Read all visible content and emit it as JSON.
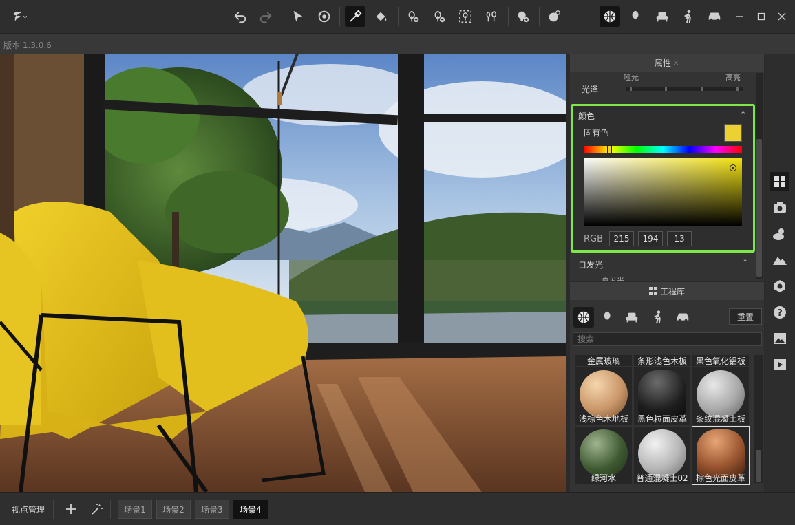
{
  "version": "版本 1.3.0.6",
  "toolbar": {
    "buttons": [
      "logo-menu",
      "undo",
      "redo",
      "select",
      "orbit",
      "eyedropper",
      "paint-bucket",
      "add-plant",
      "remove-plant",
      "plant-settings",
      "forest",
      "add-light",
      "weather"
    ],
    "categories": [
      "material",
      "plants",
      "furniture",
      "people",
      "vehicles"
    ]
  },
  "properties": {
    "title": "属性",
    "gloss_label": "光泽",
    "gloss_low": "哑光",
    "gloss_high": "高亮",
    "color_section": "颜色",
    "intrinsic_color_label": "固有色",
    "swatch_color": "#ecd132",
    "rgb_label": "RGB",
    "rgb": {
      "r": "215",
      "g": "194",
      "b": "13"
    },
    "emissive_section": "自发光",
    "emissive_item": "自发光"
  },
  "library": {
    "title": "工程库",
    "reset_label": "重置",
    "search_placeholder": "搜索",
    "top_row": [
      "金属玻璃",
      "条形浅色木板",
      "黑色氧化铝板"
    ],
    "materials": [
      {
        "name": "浅棕色木地板"
      },
      {
        "name": "黑色粒面皮革"
      },
      {
        "name": "条纹混凝土板"
      },
      {
        "name": "绿河水"
      },
      {
        "name": "普通混凝土02"
      },
      {
        "name": "棕色光面皮革",
        "selected": true
      }
    ]
  },
  "bottom": {
    "viewpoint_label": "视点管理",
    "scenes": [
      "场景1",
      "场景2",
      "场景3",
      "场景4"
    ],
    "active_scene": "场景4"
  }
}
